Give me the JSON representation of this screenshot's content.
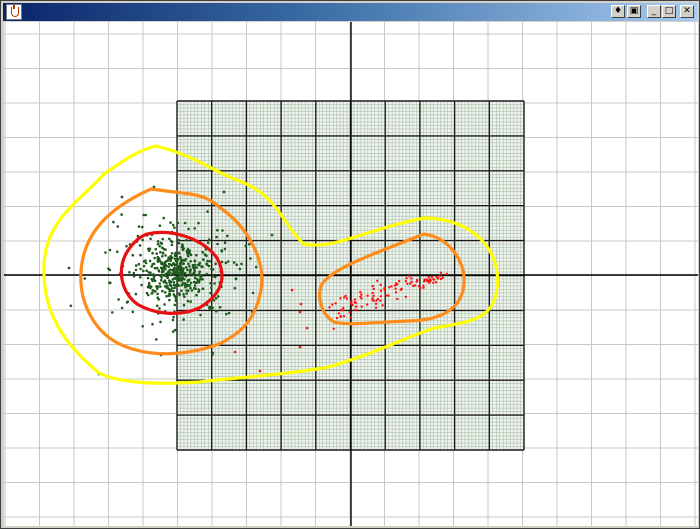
{
  "window": {
    "title": "",
    "title_buttons": [
      "restore-down-icon",
      "copy-icon",
      "minimize-icon",
      "maximize-icon",
      "close-icon"
    ]
  },
  "plot": {
    "background_grid": true,
    "axes_visible": true,
    "dense_grid_region": true,
    "series": [
      {
        "color": "#1e5a1e",
        "marker": "dot"
      },
      {
        "color": "#ff1010",
        "marker": "dot"
      }
    ],
    "contours": [
      {
        "level": "outer",
        "color": "#ffff00"
      },
      {
        "level": "middle",
        "color": "#ff8c1a"
      },
      {
        "level": "inner",
        "color": "#e81010"
      }
    ]
  }
}
